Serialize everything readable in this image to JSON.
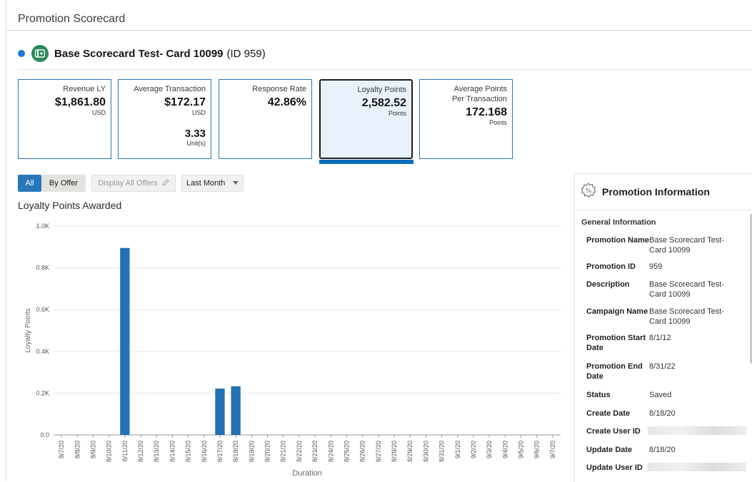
{
  "page": {
    "title": "Promotion Scorecard"
  },
  "promotion": {
    "name": "Base Scorecard Test- Card 10099",
    "id_label": "(ID 959)"
  },
  "cards": [
    {
      "label": "Revenue LY",
      "value": "$1,861.80",
      "unit": "USD"
    },
    {
      "label": "Average Transaction",
      "value": "$172.17",
      "unit": "USD",
      "value2": "3.33",
      "unit2": "Unit(s)"
    },
    {
      "label": "Response Rate",
      "value": "42.86%"
    },
    {
      "label": "Loyalty Points",
      "value": "2,582.52",
      "unit": "Points",
      "selected": true
    },
    {
      "label": "Average Points Per Transaction",
      "value": "172.168",
      "unit": "Points"
    }
  ],
  "filters": {
    "all": "All",
    "by_offer": "By Offer",
    "display_all": "Display All Offers",
    "period": "Last Month"
  },
  "chart_data": {
    "type": "bar",
    "title": "Loyalty Points Awarded",
    "xlabel": "Duration",
    "ylabel": "Loyalty Points",
    "ylim": [
      0,
      1000
    ],
    "yticks": [
      "0.0",
      "0.2K",
      "0.4K",
      "0.6K",
      "0.8K",
      "1.0K"
    ],
    "categories": [
      "8/7/20",
      "8/8/20",
      "8/9/20",
      "8/10/20",
      "8/11/20",
      "8/12/20",
      "8/13/20",
      "8/14/20",
      "8/15/20",
      "8/16/20",
      "8/17/20",
      "8/18/20",
      "8/19/20",
      "8/20/20",
      "8/21/20",
      "8/22/20",
      "8/23/20",
      "8/24/20",
      "8/25/20",
      "8/26/20",
      "8/27/20",
      "8/28/20",
      "8/29/20",
      "8/30/20",
      "8/31/20",
      "9/1/20",
      "9/2/20",
      "9/3/20",
      "9/4/20",
      "9/5/20",
      "9/6/20",
      "9/7/20"
    ],
    "values": [
      0,
      0,
      0,
      0,
      895,
      0,
      0,
      0,
      0,
      0,
      222,
      233,
      0,
      0,
      0,
      0,
      0,
      0,
      0,
      0,
      0,
      0,
      0,
      0,
      0,
      0,
      0,
      0,
      0,
      0,
      0,
      0
    ],
    "bar_color": "#2372b4",
    "grid": true
  },
  "panel": {
    "title": "Promotion Information",
    "section": "General Information",
    "rows": [
      {
        "k": "Promotion Name",
        "v": "Base Scorecard Test- Card 10099"
      },
      {
        "k": "Promotion ID",
        "v": "959"
      },
      {
        "k": "Description",
        "v": "Base Scorecard Test- Card 10099"
      },
      {
        "k": "Campaign Name",
        "v": "Base Scorecard Test- Card 10099"
      },
      {
        "k": "Promotion Start Date",
        "v": "8/1/12"
      },
      {
        "k": "Promotion End Date",
        "v": "8/31/22"
      },
      {
        "k": "Status",
        "v": "Saved"
      },
      {
        "k": "Create Date",
        "v": "8/18/20"
      },
      {
        "k": "Create User ID",
        "v": ""
      },
      {
        "k": "Update Date",
        "v": "8/18/20"
      },
      {
        "k": "Update User ID",
        "v": ""
      }
    ]
  }
}
